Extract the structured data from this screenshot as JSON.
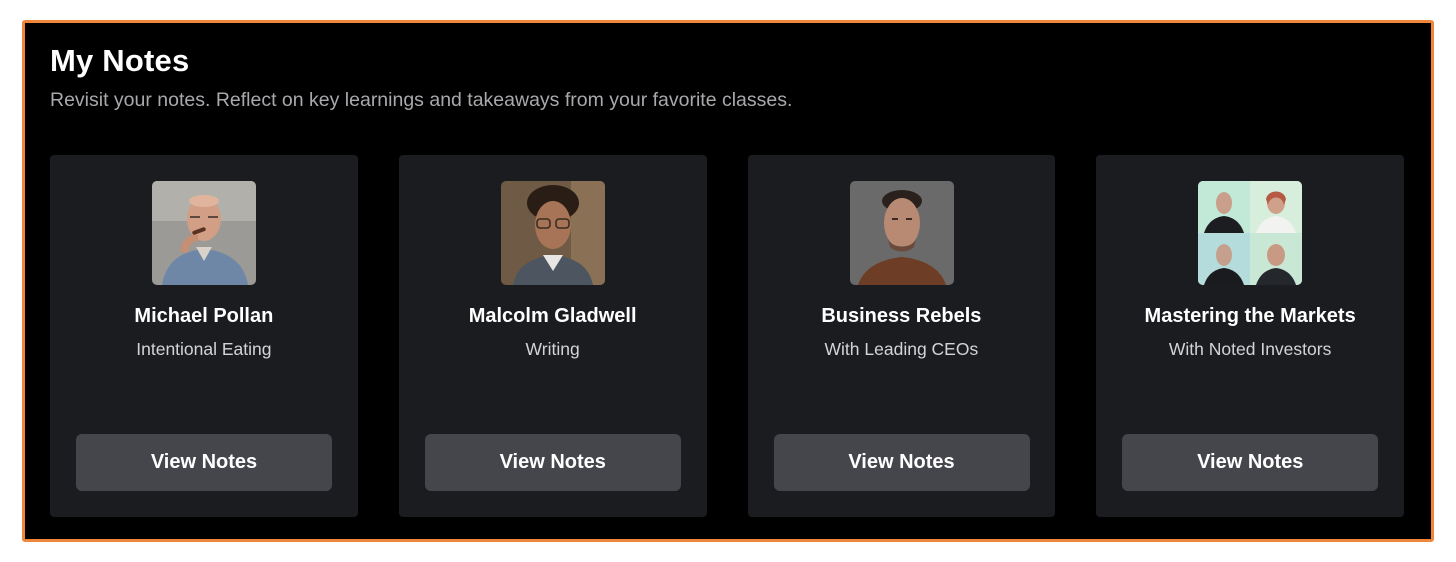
{
  "header": {
    "title": "My Notes",
    "subtitle": "Revisit your notes. Reflect on key learnings and takeaways from your favorite classes."
  },
  "cards": [
    {
      "title": "Michael Pollan",
      "subtitle": "Intentional Eating",
      "button_label": "View Notes"
    },
    {
      "title": "Malcolm Gladwell",
      "subtitle": "Writing",
      "button_label": "View Notes"
    },
    {
      "title": "Business Rebels",
      "subtitle": "With Leading CEOs",
      "button_label": "View Notes"
    },
    {
      "title": "Mastering the Markets",
      "subtitle": "With Noted Investors",
      "button_label": "View Notes"
    }
  ],
  "colors": {
    "frame_border": "#f0853c",
    "panel_background": "#000000",
    "card_background": "#1b1c20",
    "button_background": "#45464c"
  }
}
